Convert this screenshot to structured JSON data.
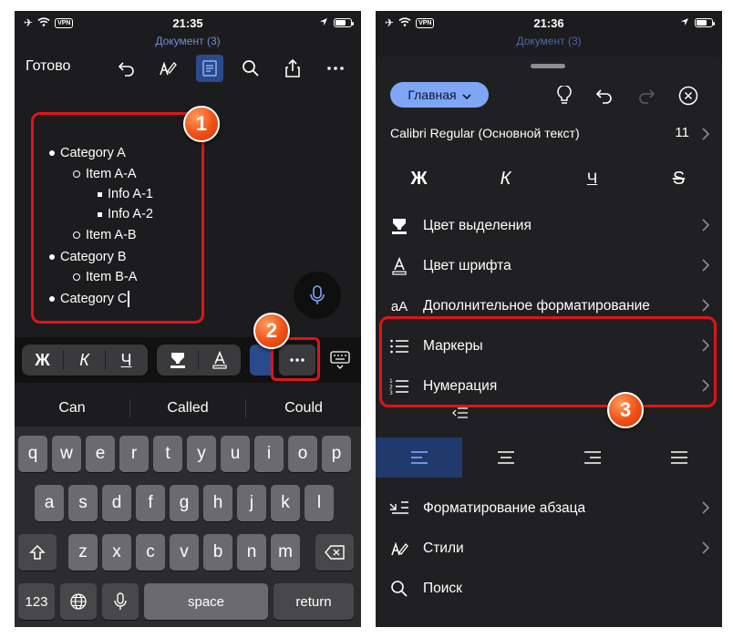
{
  "left": {
    "status": {
      "time": "21:35",
      "vpn": "VPN"
    },
    "doc_title": "Документ (3)",
    "toolbar": {
      "done": "Готово"
    },
    "document": {
      "lines": [
        {
          "text": "Category A",
          "level": 0
        },
        {
          "text": "Item A-A",
          "level": 1
        },
        {
          "text": "Info A-1",
          "level": 2
        },
        {
          "text": "Info A-2",
          "level": 2
        },
        {
          "text": "Item A-B",
          "level": 1
        },
        {
          "text": "Category B",
          "level": 0
        },
        {
          "text": "Item B-A",
          "level": 1
        },
        {
          "text": "Category C",
          "level": 0
        }
      ]
    },
    "format_bar": {
      "bold": "Ж",
      "italic": "К",
      "underline": "Ч"
    },
    "suggestions": [
      "Can",
      "Called",
      "Could"
    ],
    "keyboard": {
      "row1": [
        "q",
        "w",
        "e",
        "r",
        "t",
        "y",
        "u",
        "i",
        "o",
        "p"
      ],
      "row2": [
        "a",
        "s",
        "d",
        "f",
        "g",
        "h",
        "j",
        "k",
        "l"
      ],
      "row3": [
        "z",
        "x",
        "c",
        "v",
        "b",
        "n",
        "m"
      ],
      "numbers": "123",
      "space": "space",
      "return": "return"
    }
  },
  "right": {
    "status": {
      "time": "21:36",
      "vpn": "VPN"
    },
    "doc_title": "Документ (3)",
    "tab_label": "Главная",
    "font": {
      "name": "Calibri Regular (Основной текст)",
      "size": "11"
    },
    "styles": {
      "bold": "Ж",
      "italic": "К",
      "underline": "Ч",
      "strike": "S"
    },
    "menu": {
      "highlight": "Цвет выделения",
      "font_color": "Цвет шрифта",
      "more_formatting": "Дополнительное форматирование",
      "bullets": "Маркеры",
      "numbering": "Нумерация",
      "paragraph": "Форматирование абзаца",
      "styles": "Стили",
      "search": "Поиск"
    },
    "icon_text": {
      "more_formatting": "aA"
    }
  },
  "annotations": {
    "one": "1",
    "two": "2",
    "three": "3"
  },
  "colors": {
    "accent": "#7fa5f5",
    "highlight_red": "#e0141a",
    "badge_orange": "#f04f15",
    "background": "#1c1c1e"
  }
}
